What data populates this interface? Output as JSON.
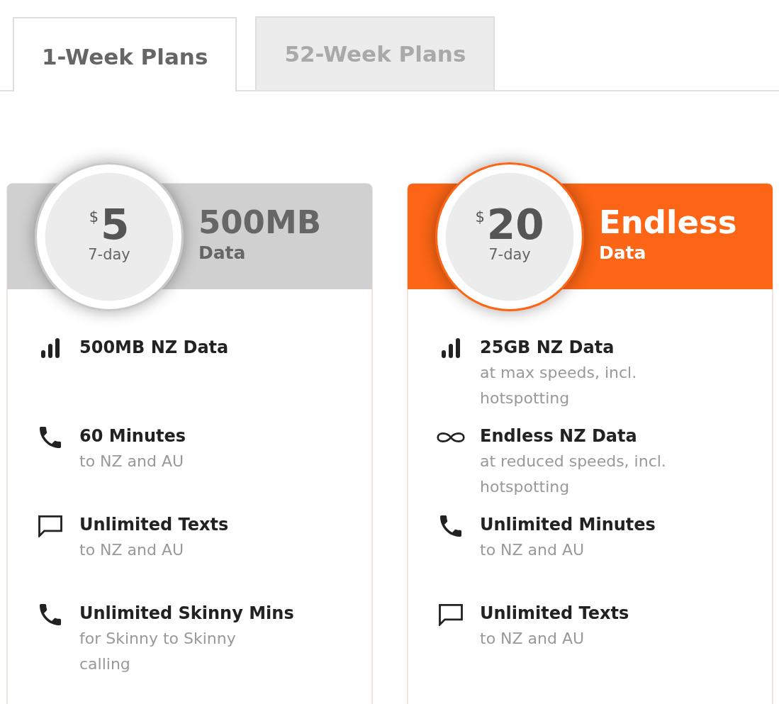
{
  "tabs": [
    {
      "label": "1-Week Plans",
      "selected": true
    },
    {
      "label": "52-Week Plans",
      "selected": false
    }
  ],
  "plans": [
    {
      "highlighted": false,
      "currency": "$",
      "price": "5",
      "period": "7-day",
      "title": "500MB",
      "subtitle": "Data",
      "features": [
        {
          "kind": "data",
          "title": "500MB NZ Data"
        },
        {
          "kind": "call",
          "title": "60 Minutes",
          "detail": "to NZ and AU"
        },
        {
          "kind": "text",
          "title": "Unlimited Texts",
          "detail": "to NZ and AU"
        },
        {
          "kind": "call",
          "title": "Unlimited Skinny Mins",
          "detail": "for Skinny to Skinny calling"
        }
      ]
    },
    {
      "highlighted": true,
      "currency": "$",
      "price": "20",
      "period": "7-day",
      "title": "Endless",
      "subtitle": "Data",
      "features": [
        {
          "kind": "data",
          "title": "25GB NZ Data",
          "detail": "at max speeds, incl. hotspotting"
        },
        {
          "kind": "endless",
          "title": "Endless NZ Data",
          "detail": "at reduced speeds, incl. hotspotting"
        },
        {
          "kind": "call",
          "title": "Unlimited Minutes",
          "detail": "to NZ and AU"
        },
        {
          "kind": "text",
          "title": "Unlimited Texts",
          "detail": "to NZ and AU"
        }
      ]
    }
  ]
}
